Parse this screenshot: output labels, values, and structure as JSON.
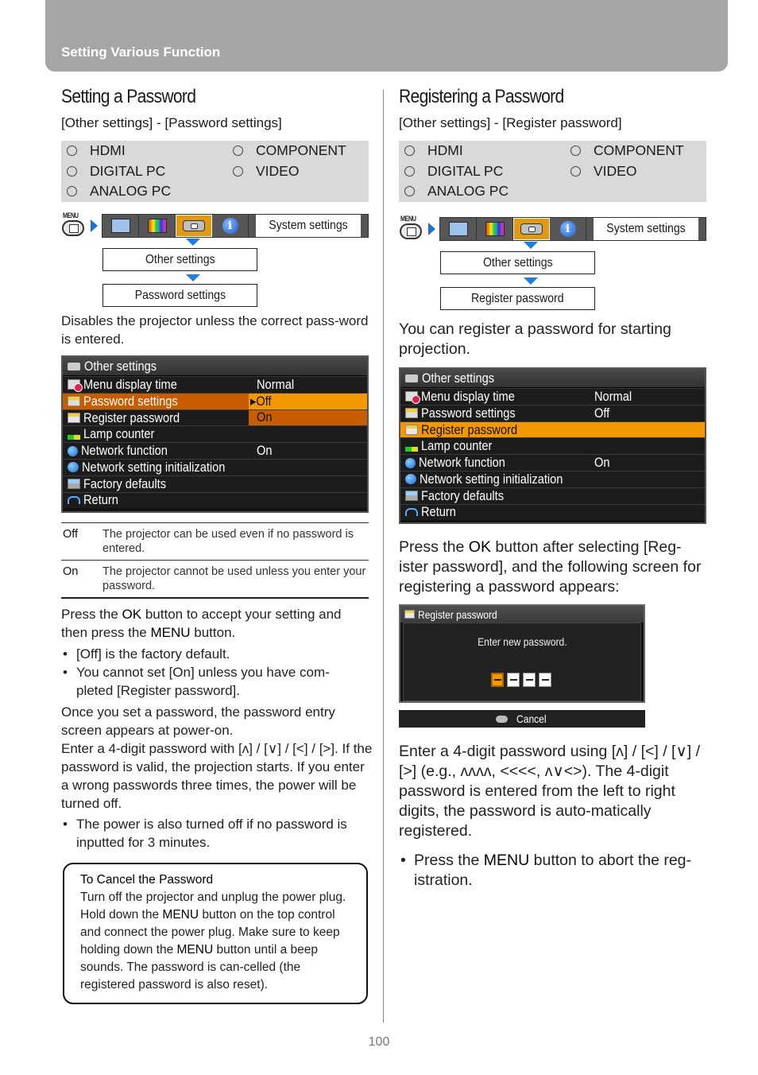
{
  "header": {
    "title": "Setting Various Function"
  },
  "left": {
    "title": "Setting a Password",
    "menu_path": "[Other settings] - [Password settings]",
    "inputs": [
      "HDMI",
      "COMPONENT",
      "DIGITAL PC",
      "VIDEO",
      "ANALOG PC"
    ],
    "nav": {
      "menu_label": "MENU",
      "tab_icons": [
        "image-adjust-icon",
        "color-icon",
        "projector-icon",
        "info-icon"
      ],
      "active_tab": 2,
      "tab_label": "System settings",
      "steps": [
        "Other settings",
        "Password settings"
      ]
    },
    "description": "Disables the projector unless the correct pass-word is entered.",
    "osd": {
      "header": "Other settings",
      "rows": [
        {
          "label": "Menu display time",
          "value": "Normal"
        },
        {
          "label": "Password settings",
          "value": "▸Off"
        },
        {
          "label": "Register password",
          "value": "On"
        },
        {
          "label": "Lamp counter",
          "value": ""
        },
        {
          "label": "Network function",
          "value": "On"
        },
        {
          "label": "Network setting initialization",
          "value": ""
        },
        {
          "label": "Factory defaults",
          "value": ""
        },
        {
          "label": "Return",
          "value": ""
        }
      ]
    },
    "options": [
      {
        "key": "Off",
        "text": "The projector can be used even if no password is entered."
      },
      {
        "key": "On",
        "text": "The projector cannot be used unless you enter your password."
      }
    ],
    "press_ok": {
      "pre": "Press the ",
      "ok": "OK",
      "mid": " button to accept your setting and then press the ",
      "menu": "MENU",
      "post": " button."
    },
    "bullets1": [
      "[Off] is the factory default.",
      "You cannot set [On] unless you have com-pleted [Register password]."
    ],
    "para2": "Once you set a password, the password entry screen appears at power-on.",
    "para3": "Enter a 4-digit password with [ʌ] / [∨] / [<] / [>]. If the password is valid, the projection starts. If you enter a wrong passwords three times, the power will be turned off.",
    "bullets2": [
      "The power is also turned off if no password is inputted for 3 minutes."
    ],
    "note": {
      "title": "To Cancel the Password",
      "pre": "Turn off the projector and unplug the power plug. Hold down the ",
      "menu1": "MENU",
      "mid": " button on the top control and connect the power plug. Make sure to keep holding down the ",
      "menu2": "MENU",
      "post": " button until a beep sounds. The password is can-celled (the registered password is also reset)."
    }
  },
  "right": {
    "title": "Registering a Password",
    "menu_path": "[Other settings] - [Register password]",
    "inputs": [
      "HDMI",
      "COMPONENT",
      "DIGITAL PC",
      "VIDEO",
      "ANALOG PC"
    ],
    "nav": {
      "menu_label": "MENU",
      "tab_label": "System settings",
      "steps": [
        "Other settings",
        "Register password"
      ]
    },
    "description": "You can register a password for starting projection.",
    "osd": {
      "header": "Other settings",
      "rows": [
        {
          "label": "Menu display time",
          "value": "Normal"
        },
        {
          "label": "Password settings",
          "value": "Off"
        },
        {
          "label": "Register password",
          "value": ""
        },
        {
          "label": "Lamp counter",
          "value": ""
        },
        {
          "label": "Network function",
          "value": "On"
        },
        {
          "label": "Network setting initialization",
          "value": ""
        },
        {
          "label": "Factory defaults",
          "value": ""
        },
        {
          "label": "Return",
          "value": ""
        }
      ]
    },
    "press_ok": {
      "pre": "Press the ",
      "ok": "OK",
      "post": " button after selecting [Reg-ister password], and the following screen for registering a password appears:"
    },
    "pw_screen": {
      "header": "Register password",
      "message": "Enter new password.",
      "digits": 4,
      "active_digit": 0,
      "cancel": "Cancel"
    },
    "para2": "Enter a 4-digit password using [ʌ] / [<] / [∨] / [>] (e.g., ʌʌʌʌ, <<<<, ʌ∨<>). The 4-digit password is entered from the left to right digits, the password is auto-matically registered.",
    "bullet": {
      "pre": "Press the ",
      "menu": "MENU",
      "post": " button to abort the reg-istration."
    }
  },
  "page_number": "100"
}
